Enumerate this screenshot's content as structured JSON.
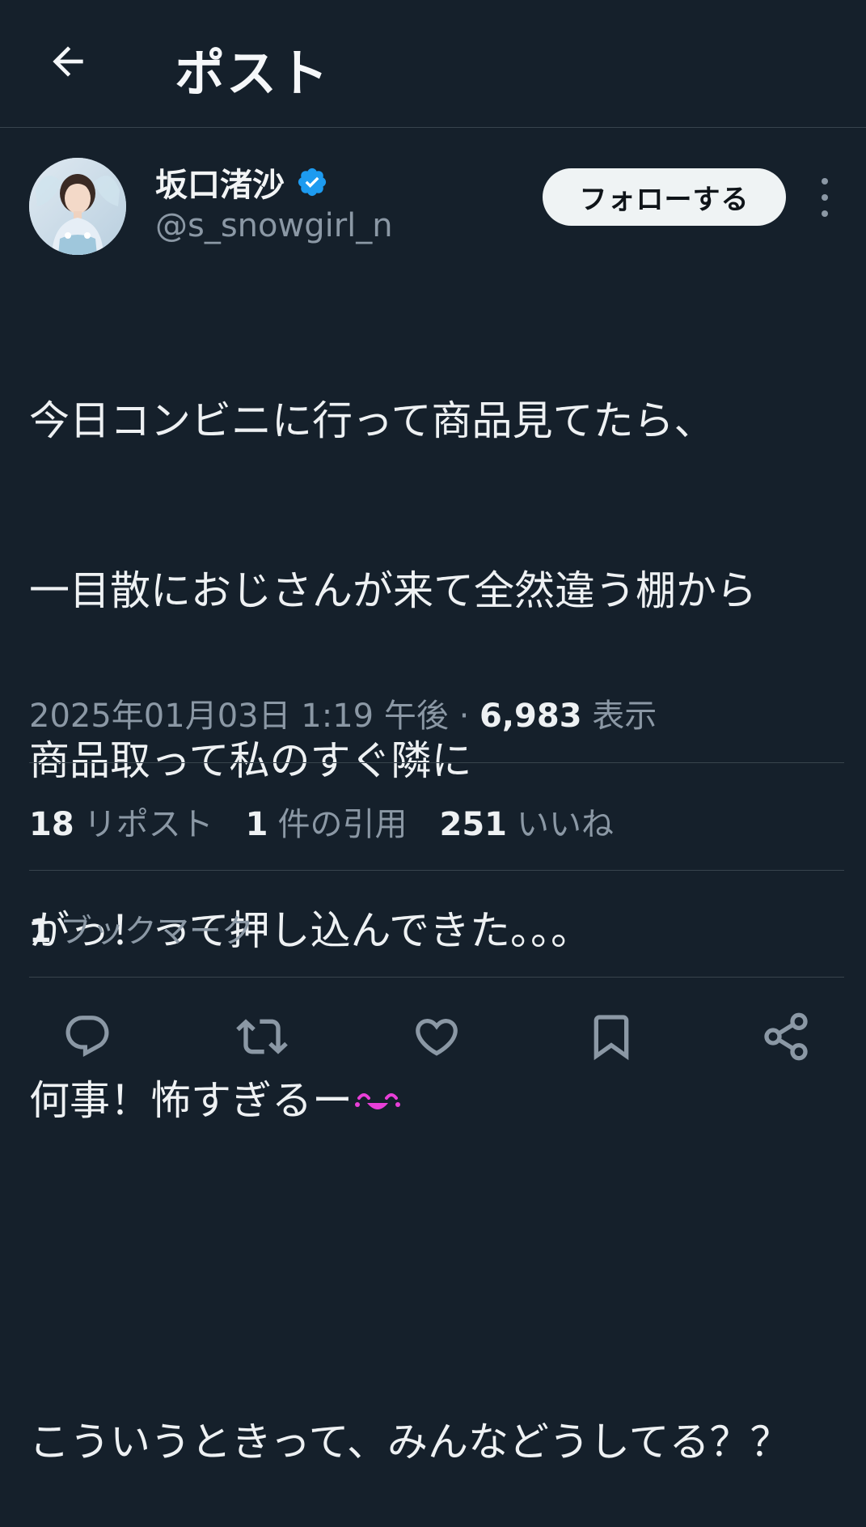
{
  "header": {
    "title": "ポスト",
    "back_icon": "arrow-left-icon"
  },
  "author": {
    "display_name": "坂口渚沙",
    "handle": "@s_snowgirl_n",
    "verified_icon": "verified-badge-icon",
    "follow_label": "フォローする"
  },
  "tweet": {
    "lines": [
      "今日コンビニに行って商品見てたら、",
      "一目散におじさんが来て全然違う棚から",
      "商品取って私のすぐ隣に",
      "がっ！って押し込んできた。。。",
      "何事！怖すぎるー",
      "",
      "こういうときって、みんなどうしてる？？"
    ],
    "emoji_icon": "crying-laughing-emoji-icon"
  },
  "meta": {
    "timestamp": "2025年01月03日 1:19 午後",
    "separator": " · ",
    "views_count": "6,983",
    "views_label": "表示"
  },
  "stats": {
    "reposts_count": "18",
    "reposts_label": "リポスト",
    "quotes_count": "1",
    "quotes_label": "件の引用",
    "likes_count": "251",
    "likes_label": "いいね",
    "bookmarks_count": "1",
    "bookmarks_label": "ブックマーク"
  },
  "actions": [
    "reply-icon",
    "repost-icon",
    "like-icon",
    "bookmark-icon",
    "share-icon"
  ],
  "colors": {
    "background": "#15202b",
    "divider": "#38444d",
    "secondary_text": "#8b98a5",
    "verified": "#1d9bf0"
  }
}
